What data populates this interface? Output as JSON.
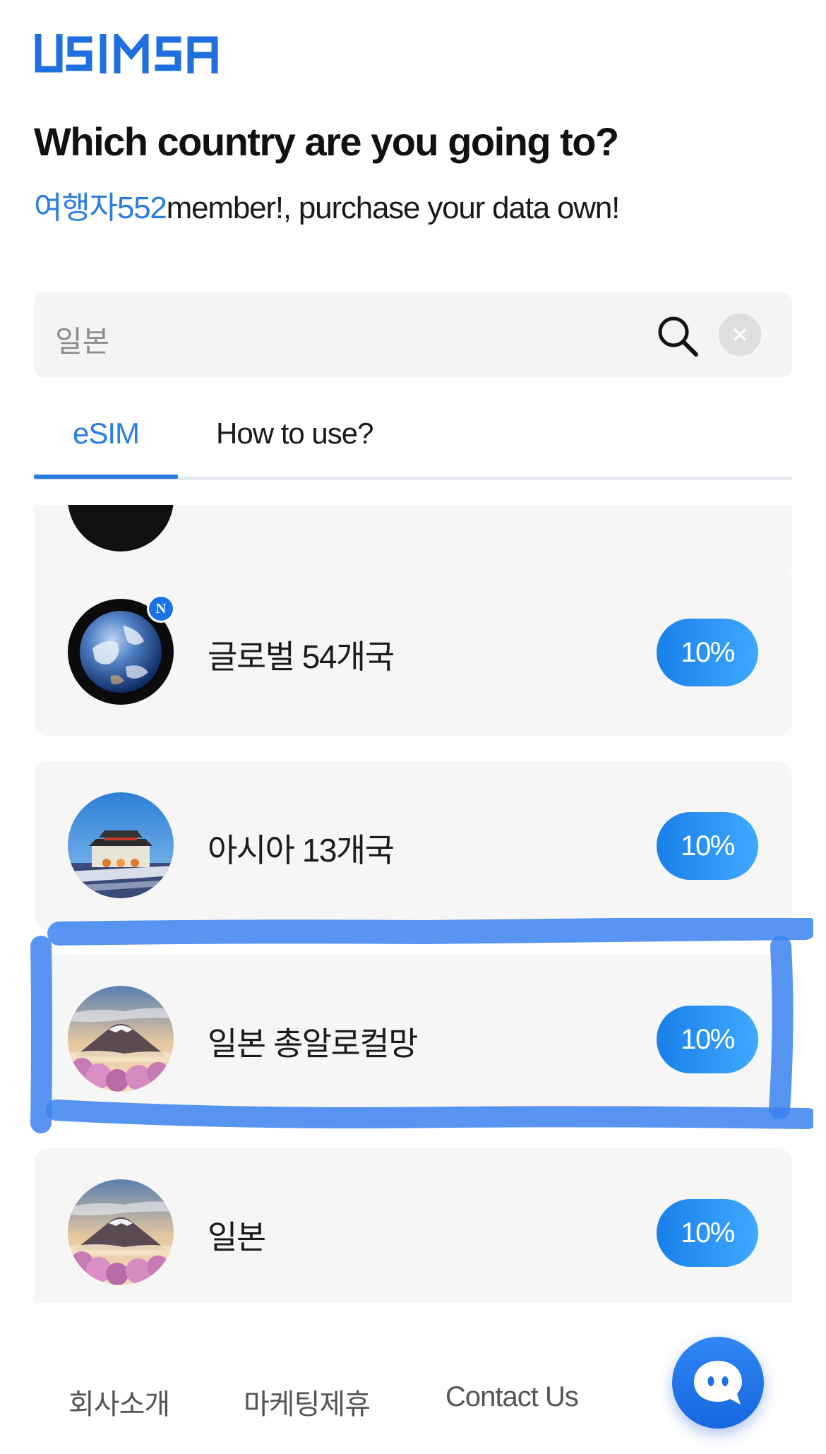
{
  "brand": {
    "logo_text": "USIMSA",
    "accent": "#2a7de1"
  },
  "header": {
    "title": "Which country are you going to?",
    "nickname": "여행자552",
    "subtitle_rest": "member!, purchase your data own!"
  },
  "search": {
    "value": "일본",
    "icon": "search-icon",
    "clear_icon": "close-icon"
  },
  "tabs": [
    {
      "label": "eSIM",
      "active": true
    },
    {
      "label": "How to use?",
      "active": false
    }
  ],
  "products": [
    {
      "name": "글로벌 54개국",
      "discount": "10%",
      "image": "earth-globe",
      "new_badge": "N"
    },
    {
      "name": "아시아 13개국",
      "discount": "10%",
      "image": "gyeongbokgung-palace"
    },
    {
      "name": "일본 총알로컬망",
      "discount": "10%",
      "image": "mount-fuji-cherry-blossom",
      "highlighted": true
    },
    {
      "name": "일본",
      "discount": "10%",
      "image": "mount-fuji-cherry-blossom"
    }
  ],
  "footer": {
    "links": [
      "회사소개",
      "마케팅제휴",
      "Contact Us"
    ],
    "chat_icon": "chat-bubble-icon"
  },
  "colors": {
    "badge_start": "#1a80ea",
    "badge_end": "#3fa9ff",
    "highlight_marker": "#3b82f0"
  }
}
